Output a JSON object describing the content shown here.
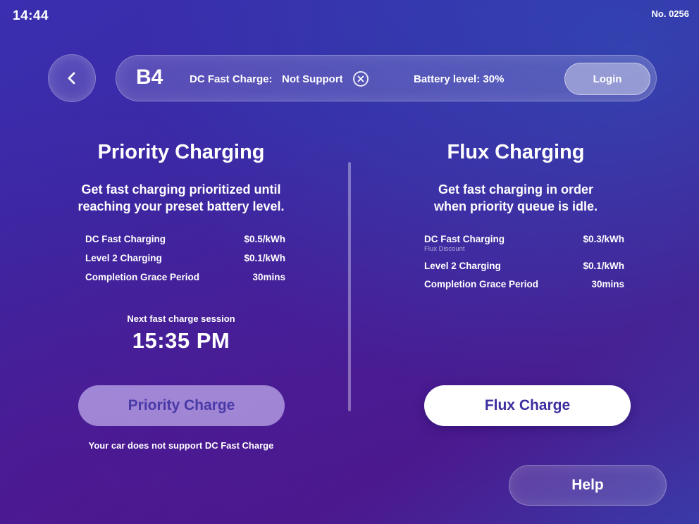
{
  "status_bar": {
    "time": "14:44",
    "station_number": "No. 0256"
  },
  "header": {
    "back_icon": "chevron-left-icon",
    "bay": "B4",
    "dc_fast_charge_label": "DC Fast Charge:",
    "dc_fast_charge_value": "Not Support",
    "dc_status_icon": "x-circle-icon",
    "battery_level": "Battery level: 30%",
    "login_label": "Login"
  },
  "priority": {
    "title": "Priority Charging",
    "description_line1": "Get fast charging prioritized until",
    "description_line2": "reaching your preset battery level.",
    "rates": [
      {
        "name": "DC Fast Charging",
        "price": "$0.5/kWh"
      },
      {
        "name": "Level 2 Charging",
        "price": "$0.1/kWh"
      },
      {
        "name": "Completion Grace Period",
        "price": "30mins"
      }
    ],
    "next_session_label": "Next fast charge session",
    "next_session_time": "15:35 PM",
    "button_label": "Priority Charge",
    "unsupported_note": "Your car does not support DC Fast Charge"
  },
  "flux": {
    "title": "Flux Charging",
    "description_line1": "Get fast charging in order",
    "description_line2": "when priority queue is idle.",
    "rates": [
      {
        "name": "DC Fast Charging",
        "note": "Flux Discount",
        "price": "$0.3/kWh"
      },
      {
        "name": "Level 2 Charging",
        "price": "$0.1/kWh"
      },
      {
        "name": "Completion Grace Period",
        "price": "30mins"
      }
    ],
    "button_label": "Flux Charge"
  },
  "help_label": "Help",
  "colors": {
    "background_start": "#3a2fb0",
    "background_end": "#4a1a8e",
    "primary_button_text": "#3b2fa0",
    "disabled_button_bg": "#beaaeb"
  }
}
